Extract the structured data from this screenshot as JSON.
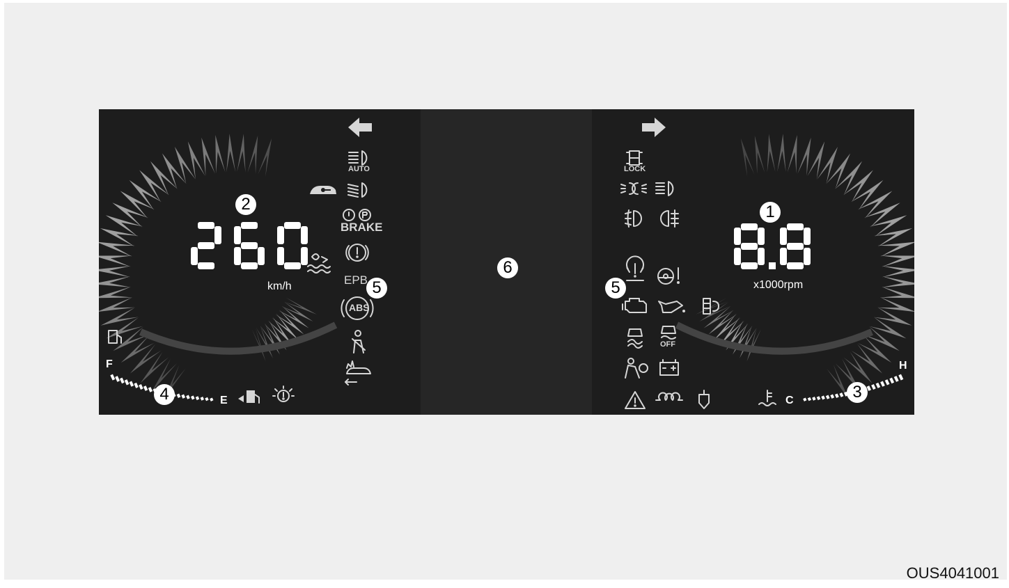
{
  "speedometer": {
    "value": "260",
    "unit": "km/h"
  },
  "tachometer": {
    "value": "8.8",
    "unit": "x1000rpm"
  },
  "fuel_gauge": {
    "full_label": "F",
    "empty_label": "E"
  },
  "temp_gauge": {
    "cold_label": "C",
    "hot_label": "H"
  },
  "callouts": {
    "tachometer": "1",
    "speedometer": "2",
    "temp_gauge": "3",
    "fuel_gauge": "4",
    "warning_lights": "5",
    "lcd_display": "6"
  },
  "indicator_labels": {
    "auto": "AUTO",
    "brake": "BRAKE",
    "epb": "EPB",
    "abs": "ABS",
    "lock": "LOCK",
    "esc_off": "OFF"
  },
  "icons": [
    "turn-left-arrow-icon",
    "turn-right-arrow-icon",
    "auto-headlight-icon",
    "immobilizer-icon",
    "low-beam-icon",
    "brake-warning-icon",
    "epb-warning-icon",
    "washer-fluid-icon",
    "abs-icon",
    "seatbelt-icon",
    "forward-collision-icon",
    "awd-lock-icon",
    "position-lamp-icon",
    "high-beam-icon",
    "front-fog-icon",
    "rear-fog-icon",
    "tpms-icon",
    "steering-warning-icon",
    "check-engine-icon",
    "oil-pressure-icon",
    "emission-icon",
    "esc-icon",
    "esc-off-icon",
    "airbag-icon",
    "charging-icon",
    "master-warning-icon",
    "glow-plug-icon",
    "fuel-filter-icon",
    "fuel-pump-icon",
    "fuel-door-icon",
    "low-tire-icon",
    "coolant-temp-icon"
  ],
  "figure_code": "OUS4041001"
}
